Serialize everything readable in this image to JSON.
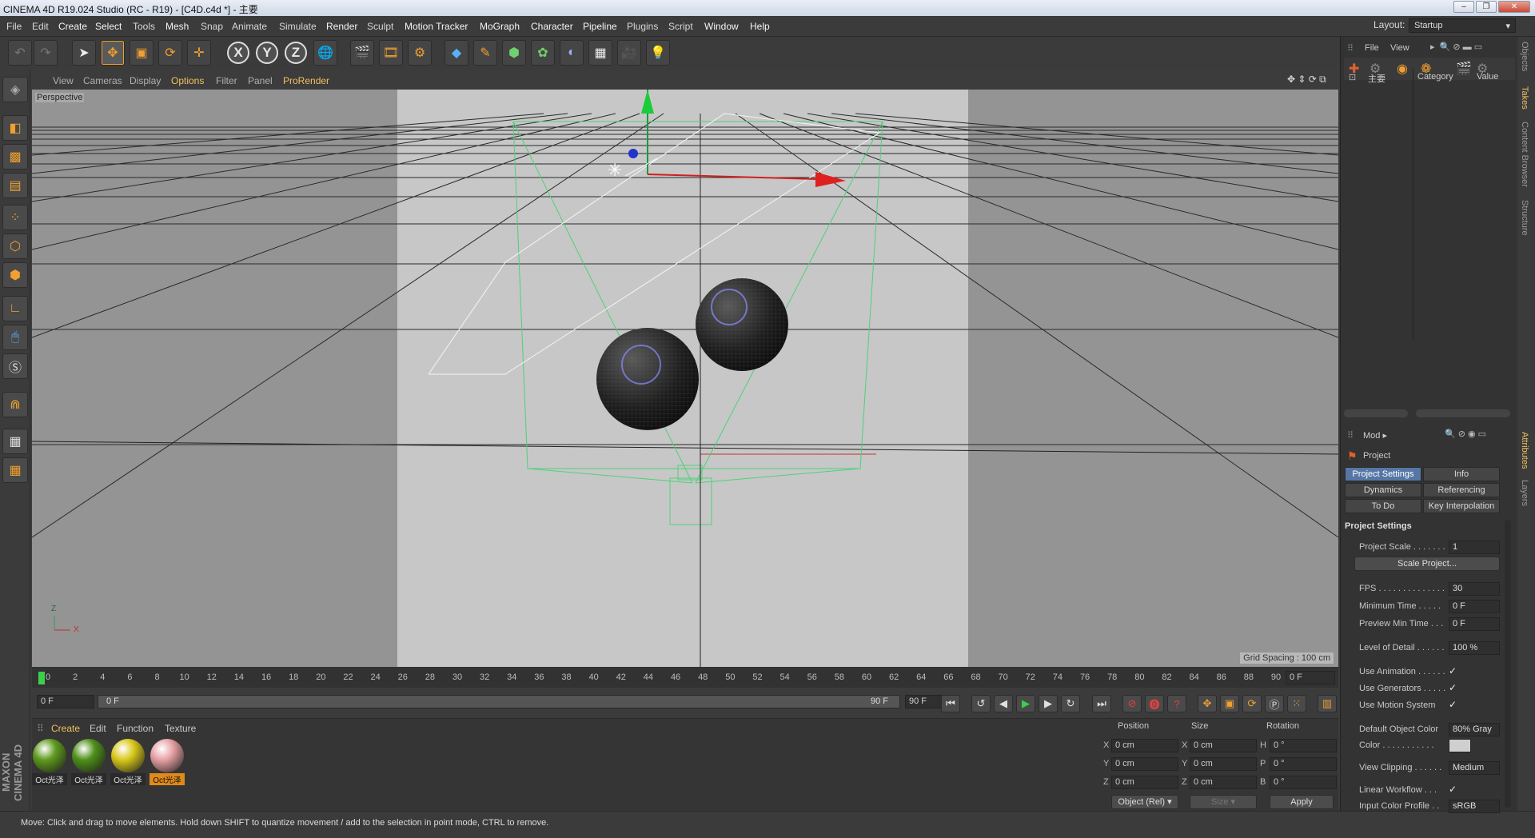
{
  "window": {
    "title": "CINEMA 4D R19.024 Studio (RC - R19) - [C4D.c4d *] - 主要",
    "layout_label": "Layout:",
    "layout_value": "Startup"
  },
  "menu": [
    "File",
    "Edit",
    "Create",
    "Select",
    "Tools",
    "Mesh",
    "Snap",
    "Animate",
    "Simulate",
    "Render",
    "Sculpt",
    "Motion Tracker",
    "MoGraph",
    "Character",
    "Pipeline",
    "Plugins",
    "Script",
    "Window",
    "Help"
  ],
  "toolbar": {
    "x": "X",
    "y": "Y",
    "z": "Z"
  },
  "viewport": {
    "menu": [
      "View",
      "Cameras",
      "Display",
      "Options",
      "Filter",
      "Panel",
      "ProRender"
    ],
    "label": "Perspective",
    "grid_spacing": "Grid Spacing : 100 cm",
    "axis_z": "Z",
    "axis_x": "X"
  },
  "timeline": {
    "ticks": [
      "0",
      "2",
      "4",
      "6",
      "8",
      "10",
      "12",
      "14",
      "16",
      "18",
      "20",
      "22",
      "24",
      "26",
      "28",
      "30",
      "32",
      "34",
      "36",
      "38",
      "40",
      "42",
      "44",
      "46",
      "48",
      "50",
      "52",
      "54",
      "56",
      "58",
      "60",
      "62",
      "64",
      "66",
      "68",
      "70",
      "72",
      "74",
      "76",
      "78",
      "80",
      "82",
      "84",
      "86",
      "88",
      "90"
    ],
    "current": "0 F",
    "start": "0 F",
    "range_start": "0 F",
    "range_end": "90 F",
    "end": "90 F",
    "current_frame": 0
  },
  "materials": {
    "menu": [
      "Create",
      "Edit",
      "Function",
      "Texture"
    ],
    "items": [
      {
        "label": "Oct光泽",
        "color": "#5f9a1e",
        "selected": false
      },
      {
        "label": "Oct光泽",
        "color": "#4f8f1a",
        "selected": false
      },
      {
        "label": "Oct光泽",
        "color": "#d8c81a",
        "selected": false
      },
      {
        "label": "Oct光泽",
        "color": "#e7a0a4",
        "selected": true
      }
    ]
  },
  "coords": {
    "headers": [
      "Position",
      "Size",
      "Rotation"
    ],
    "rows": [
      {
        "axis": "X",
        "pos": "0 cm",
        "saxis": "X",
        "size": "0 cm",
        "raxis": "H",
        "rot": "0 °"
      },
      {
        "axis": "Y",
        "pos": "0 cm",
        "saxis": "Y",
        "size": "0 cm",
        "raxis": "P",
        "rot": "0 °"
      },
      {
        "axis": "Z",
        "pos": "0 cm",
        "saxis": "Z",
        "size": "0 cm",
        "raxis": "B",
        "rot": "0 °"
      }
    ],
    "mode": "Object (Rel)",
    "size_mode": "Size",
    "apply": "Apply"
  },
  "objects": {
    "menu": [
      "File",
      "View"
    ],
    "item": "主要",
    "col_category": "Category",
    "col_value": "Value"
  },
  "attributes": {
    "mode": "Mod",
    "section": "Project",
    "tabs": [
      "Project Settings",
      "Info",
      "Dynamics",
      "Referencing",
      "To Do",
      "Key Interpolation"
    ],
    "group": "Project Settings",
    "scale_btn": "Scale Project...",
    "props": [
      {
        "label": "Project Scale . . . . . . .",
        "value": "1"
      },
      {
        "label": "FPS . . . . . . . . . . . . . .",
        "value": "30"
      },
      {
        "label": "Minimum Time . . . . .",
        "value": "0 F"
      },
      {
        "label": "Preview Min Time . . .",
        "value": "0 F"
      },
      {
        "label": "Level of Detail . . . . . .",
        "value": "100 %"
      },
      {
        "label": "Use Animation . . . . . .",
        "value": "✓"
      },
      {
        "label": "Use Generators . . . . .",
        "value": "✓"
      },
      {
        "label": "Use Motion System",
        "value": "✓"
      },
      {
        "label": "Default Object Color",
        "value": "80% Gray"
      },
      {
        "label": "Color . . . . . . . . . . .",
        "value": ""
      },
      {
        "label": "View Clipping . . . . . .",
        "value": "Medium"
      },
      {
        "label": "Linear Workflow . . .",
        "value": "✓"
      },
      {
        "label": "Input Color Profile . .",
        "value": "sRGB"
      }
    ]
  },
  "right_tabs": [
    "Objects",
    "Takes",
    "Content Browser",
    "Structure",
    "Attributes",
    "Layers"
  ],
  "status": "Move: Click and drag to move elements. Hold down SHIFT to quantize movement / add to the selection in point mode, CTRL to remove.",
  "brand": "MAXON CINEMA 4D"
}
